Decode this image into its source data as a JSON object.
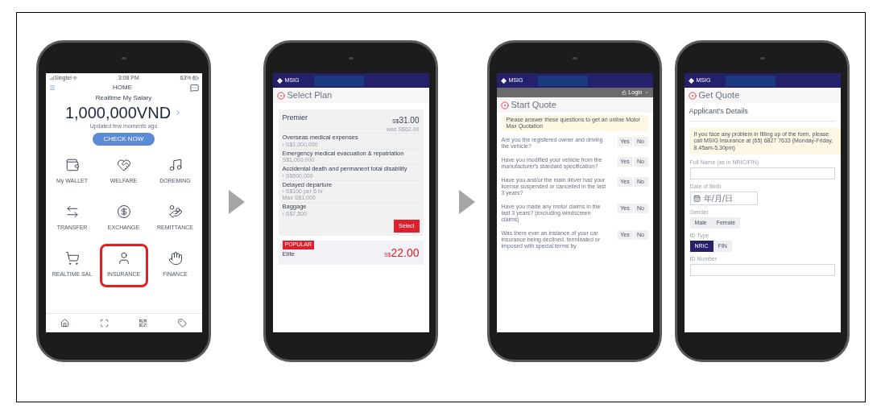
{
  "phones": [
    {
      "kind": "home",
      "status_bar": {
        "carrier": "Singtel",
        "time": "3:08 PM",
        "battery": "63%"
      },
      "title": "HOME",
      "salary_label": "Realtime My Salary",
      "amount": "1,000,000VND",
      "updated": "Updated few moments ago",
      "button": "CHECK NOW",
      "tiles": [
        {
          "label": "My WALLET",
          "selected": false
        },
        {
          "label": "WELFARE",
          "selected": false
        },
        {
          "label": "DOREMING",
          "selected": false
        },
        {
          "label": "TRANSFER",
          "selected": false
        },
        {
          "label": "EXCHANGE",
          "selected": false
        },
        {
          "label": "REMITTANCE",
          "selected": false
        },
        {
          "label": "REALTIME SAL",
          "selected": false
        },
        {
          "label": "INSURANCE",
          "selected": true
        },
        {
          "label": "FINANCE",
          "selected": false
        }
      ]
    },
    {
      "kind": "plans",
      "brand": "MSIG",
      "title": "Select Plan",
      "plans": [
        {
          "name": "Premier",
          "currency": "S$",
          "price": "31.00",
          "was": "was S$62.00",
          "benefits": [
            {
              "name": "Overseas medical expenses",
              "amount": "› S$1,000,000"
            },
            {
              "name": "Emergency medical evacuation & repatriation",
              "amount": "S$1,000,000"
            },
            {
              "name": "Accidental death and permanent total disability",
              "amount": "› S$500,000"
            },
            {
              "name": "Delayed departure",
              "amount": "› S$100 per 6 hr",
              "note": "Max S$1,000"
            },
            {
              "name": "Baggage",
              "amount": "› S$7,500"
            }
          ],
          "button": "Select"
        },
        {
          "name": "Elite",
          "badge": "POPULAR",
          "currency": "S$",
          "price": "22.00"
        }
      ]
    },
    {
      "kind": "quote",
      "brand": "MSIG",
      "login": "Login",
      "title": "Start Quote",
      "notice": "Please answer these questions to get an online Motor Max Quotation",
      "questions": [
        {
          "text": "Are you the registered owner and driving the vehicle?",
          "yes": "Yes",
          "no": "No"
        },
        {
          "text": "Have you modified your vehicle from the manufacturer's standard specification?",
          "yes": "Yes",
          "no": "No"
        },
        {
          "text": "Have you and/or the main driver had your license suspended or cancelled in the last 3 years?",
          "yes": "Yes",
          "no": "No"
        },
        {
          "text": "Have you made any motor claims in the last 3 years? (excluding windscreen claims)",
          "yes": "Yes",
          "no": "No"
        },
        {
          "text": "Was there ever an instance of your car insurance being declined, terminated or imposed with special terms by",
          "yes": "Yes",
          "no": "No"
        }
      ]
    },
    {
      "kind": "form",
      "brand": "MSIG",
      "title": "Get Quote",
      "section": "Applicant's Details",
      "notice": "If you face any problem in filling up of the form, please call MSIG Insurance at (65) 6827 7633 (Monday-Friday, 8.45am-5.30pm)",
      "fields": [
        {
          "kind": "text",
          "label": "Full Name (as in NRIC/FIN)"
        },
        {
          "kind": "date",
          "label": "Date of Birth",
          "placeholder": "年/月/日"
        },
        {
          "kind": "choice",
          "label": "Gender",
          "options": [
            {
              "label": "Male",
              "selected": false
            },
            {
              "label": "Female",
              "selected": false
            }
          ]
        },
        {
          "kind": "choice",
          "label": "ID Type",
          "options": [
            {
              "label": "NRIC",
              "selected": true
            },
            {
              "label": "FIN",
              "selected": false
            }
          ]
        },
        {
          "kind": "text",
          "label": "ID Number"
        }
      ]
    }
  ]
}
